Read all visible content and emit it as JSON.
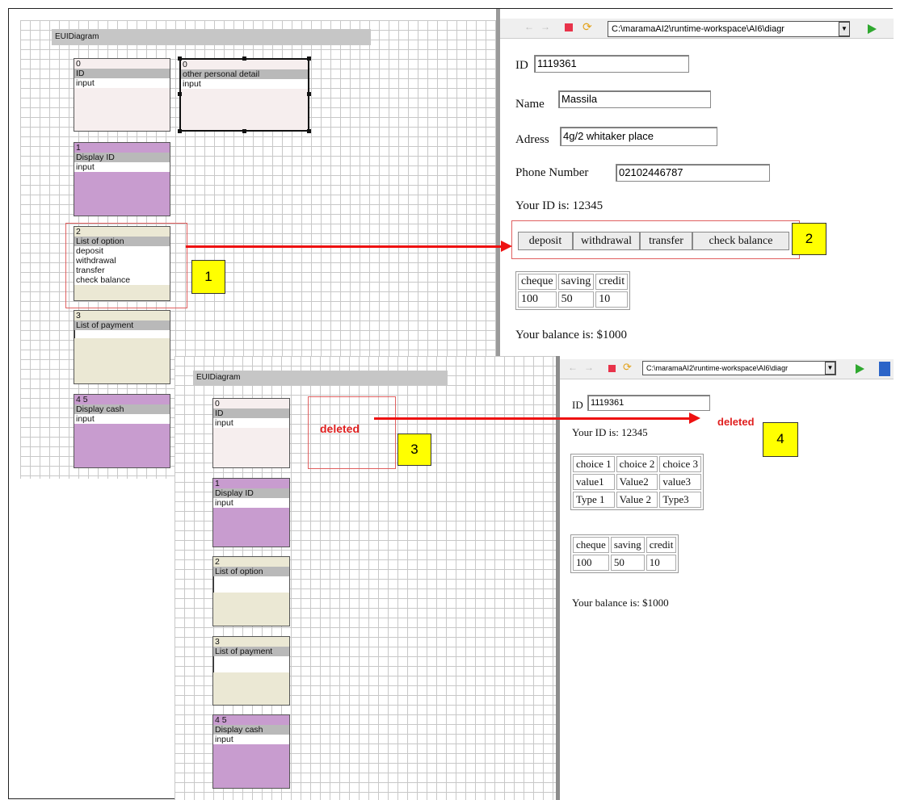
{
  "top_editor": {
    "diagram_title": "EUIDiagram",
    "components": {
      "id": {
        "rows": [
          "0",
          "ID",
          "input"
        ]
      },
      "other": {
        "rows": [
          "0",
          "other personal detail",
          "input"
        ]
      },
      "display_id": {
        "rows": [
          "1",
          "Display ID",
          "input"
        ]
      },
      "list_option": {
        "rows": [
          "2",
          "List of option",
          "deposit",
          "withdrawal",
          "transfer",
          "check balance"
        ]
      },
      "list_payment": {
        "rows": [
          "3",
          "List of payment"
        ]
      },
      "display_cash": {
        "rows": [
          "4 5",
          "Display cash",
          "input"
        ]
      }
    }
  },
  "top_browser": {
    "address": "C:\\maramaAI2\\runtime-workspace\\AI6\\diagr",
    "dropdown_glyph": "▼",
    "fields": [
      {
        "label": "ID",
        "value": "1119361"
      },
      {
        "label": "Name",
        "value": "Massila"
      },
      {
        "label": "Adress",
        "value": "4g/2 whitaker place"
      },
      {
        "label": "Phone Number",
        "value": "02102446787"
      }
    ],
    "your_id": "Your ID is: 12345",
    "buttons": [
      "deposit",
      "withdrawal",
      "transfer",
      "check balance"
    ],
    "cash_table": {
      "header": [
        "cheque",
        "saving",
        "credit"
      ],
      "rows": [
        [
          "100",
          "50",
          "10"
        ]
      ]
    },
    "balance": "Your balance is: $1000"
  },
  "bottom_editor": {
    "diagram_title": "EUIDiagram",
    "deleted_label": "deleted",
    "components": {
      "id": {
        "rows": [
          "0",
          "ID",
          "input"
        ]
      },
      "display_id": {
        "rows": [
          "1",
          "Display ID",
          "input"
        ]
      },
      "list_option": {
        "rows": [
          "2",
          "List of option"
        ]
      },
      "list_payment": {
        "rows": [
          "3",
          "List of payment"
        ]
      },
      "display_cash": {
        "rows": [
          "4 5",
          "Display cash",
          "input"
        ]
      }
    }
  },
  "bottom_browser": {
    "address": "C:\\maramaAI2\\runtime-workspace\\AI6\\diagr",
    "dropdown_glyph": "▼",
    "id_label": "ID",
    "id_value": "1119361",
    "deleted_label": "deleted",
    "your_id": "Your ID is: 12345",
    "choice_table": {
      "rows": [
        [
          "choice 1",
          "choice 2",
          "choice 3"
        ],
        [
          "value1",
          "Value2",
          "value3"
        ],
        [
          "Type 1",
          "Value 2",
          "Type3"
        ]
      ]
    },
    "cash_table": {
      "rows": [
        [
          "cheque",
          "saving",
          "credit"
        ],
        [
          "100",
          "50",
          "10"
        ]
      ]
    },
    "balance": "Your balance is: $1000"
  },
  "annotations": [
    "1",
    "2",
    "3",
    "4"
  ],
  "colors": {
    "arrow": "#ee1111",
    "callout": "#ffff00",
    "deleted": "#e01f1f",
    "purple_component": "#c89ccf",
    "beige_component": "#ebe8d4"
  },
  "icons": [
    "back-icon",
    "forward-icon",
    "stop-icon",
    "refresh-icon",
    "dropdown-icon",
    "go-icon"
  ]
}
